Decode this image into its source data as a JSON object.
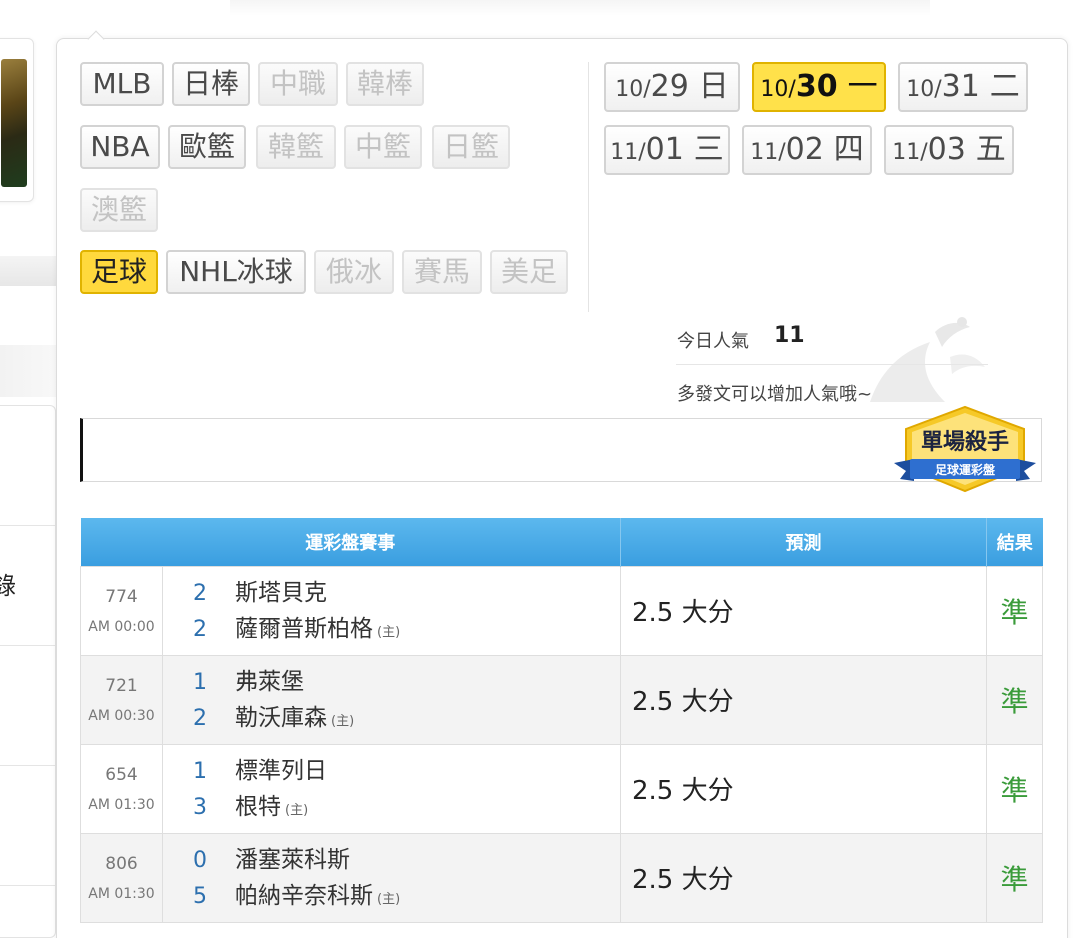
{
  "sports": [
    {
      "label": "MLB",
      "state": "normal"
    },
    {
      "label": "日棒",
      "state": "normal"
    },
    {
      "label": "中職",
      "state": "disabled"
    },
    {
      "label": "韓棒",
      "state": "disabled"
    },
    {
      "label": "NBA",
      "state": "normal"
    },
    {
      "label": "歐籃",
      "state": "normal"
    },
    {
      "label": "韓籃",
      "state": "disabled"
    },
    {
      "label": "中籃",
      "state": "disabled"
    },
    {
      "label": "日籃",
      "state": "disabled"
    },
    {
      "label": "澳籃",
      "state": "disabled"
    },
    {
      "label": "足球",
      "state": "active"
    },
    {
      "label": "NHL冰球",
      "state": "normal"
    },
    {
      "label": "俄冰",
      "state": "disabled"
    },
    {
      "label": "賽馬",
      "state": "disabled"
    },
    {
      "label": "美足",
      "state": "disabled"
    }
  ],
  "dates": [
    {
      "md": "10/",
      "dd": "29",
      "wd": "日",
      "active": false
    },
    {
      "md": "10/",
      "dd": "30",
      "wd": "一",
      "active": true
    },
    {
      "md": "10/",
      "dd": "31",
      "wd": "二",
      "active": false
    },
    {
      "md": "11/",
      "dd": "01",
      "wd": "三",
      "active": false
    },
    {
      "md": "11/",
      "dd": "02",
      "wd": "四",
      "active": false
    },
    {
      "md": "11/",
      "dd": "03",
      "wd": "五",
      "active": false
    }
  ],
  "popularity": {
    "label": "今日人氣",
    "value": "11",
    "hint": "多發文可以增加人氣哦~"
  },
  "badge": {
    "title": "單場殺手",
    "subtitle": "足球運彩盤"
  },
  "sidebar": {
    "partial_glyph": "錄"
  },
  "table": {
    "headers": [
      "運彩盤賽事",
      "預測",
      "結果"
    ],
    "home_marker": "(主)",
    "rows": [
      {
        "num": "774",
        "time": "AM 00:00",
        "away_score": "2",
        "away": "斯塔貝克",
        "home_score": "2",
        "home": "薩爾普斯柏格",
        "prediction": "2.5 大分",
        "result": "準"
      },
      {
        "num": "721",
        "time": "AM 00:30",
        "away_score": "1",
        "away": "弗萊堡",
        "home_score": "2",
        "home": "勒沃庫森",
        "prediction": "2.5 大分",
        "result": "準"
      },
      {
        "num": "654",
        "time": "AM 01:30",
        "away_score": "1",
        "away": "標準列日",
        "home_score": "3",
        "home": "根特",
        "prediction": "2.5 大分",
        "result": "準"
      },
      {
        "num": "806",
        "time": "AM 01:30",
        "away_score": "0",
        "away": "潘塞萊科斯",
        "home_score": "5",
        "home": "帕納辛奈科斯",
        "prediction": "2.5 大分",
        "result": "準"
      }
    ]
  },
  "colors": {
    "active_tag": "#ffd93d",
    "header_blue": "#3a9ee0",
    "result_green": "#3a9b3a",
    "score_blue": "#2c6fae"
  }
}
